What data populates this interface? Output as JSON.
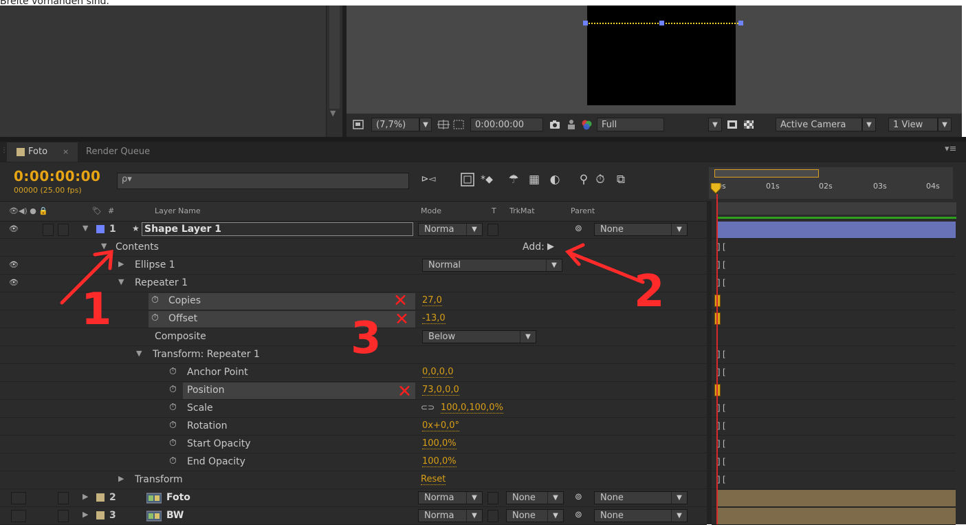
{
  "caption": "Breite vorhanden sind.",
  "viewer": {
    "zoom": "(7,7%)",
    "timecode": "0:00:00:00",
    "resolution": "Full",
    "camera": "Active Camera",
    "views": "1 View"
  },
  "tabs": {
    "active": "Foto",
    "close_glyph": "×",
    "other": "Render Queue",
    "menu_glyph": "▾≡"
  },
  "timeline": {
    "current_time": "0:00:00:00",
    "fps": "00000 (25.00 fps)",
    "search_glyph": "ρ▾",
    "ruler_labels": [
      "0s",
      "01s",
      "02s",
      "03s",
      "04s"
    ],
    "headers": {
      "hash": "#",
      "layer_name": "Layer Name",
      "mode": "Mode",
      "t": "T",
      "trkmat": "TrkMat",
      "parent": "Parent"
    }
  },
  "layers": {
    "l1": {
      "num": "1",
      "name": "Shape Layer 1",
      "mode": "Norma",
      "parent": "None"
    },
    "contents": "Contents",
    "add_label": "Add:",
    "ellipse": {
      "name": "Ellipse 1",
      "mode": "Normal"
    },
    "repeater": "Repeater 1",
    "copies": {
      "label": "Copies",
      "value": "27,0"
    },
    "offset": {
      "label": "Offset",
      "value": "-13,0"
    },
    "composite": {
      "label": "Composite",
      "value": "Below"
    },
    "transform_rep": "Transform: Repeater 1",
    "anchor": {
      "label": "Anchor Point",
      "value": "0,0,0,0"
    },
    "position": {
      "label": "Position",
      "value": "73,0,0,0"
    },
    "scale": {
      "label": "Scale",
      "value": "100,0,100,0%"
    },
    "rotation": {
      "label": "Rotation",
      "value": "0x+0,0°"
    },
    "start_opacity": {
      "label": "Start Opacity",
      "value": "100,0%"
    },
    "end_opacity": {
      "label": "End Opacity",
      "value": "100,0%"
    },
    "transform": {
      "label": "Transform",
      "value": "Reset"
    },
    "l2": {
      "num": "2",
      "name": "Foto",
      "mode": "Norma",
      "trkmat": "None",
      "parent": "None"
    },
    "l3": {
      "num": "3",
      "name": "BW",
      "mode": "Norma",
      "trkmat": "None",
      "parent": "None"
    }
  },
  "annotations": {
    "n1": "1",
    "n2": "2",
    "n3": "3",
    "x": "✕"
  },
  "colors": {
    "timecode": "#e7a514",
    "value": "#d99f16",
    "annotation": "#ff2a2a",
    "shape_layer_label": "#6f83ff",
    "footage_label": "#c5b27f",
    "work_area": "#2da11e"
  },
  "icons": [
    "eye-icon",
    "star-icon",
    "stopwatch-icon",
    "footage-icon",
    "camera-icon",
    "link-icon",
    "spiral-parent-icon"
  ]
}
